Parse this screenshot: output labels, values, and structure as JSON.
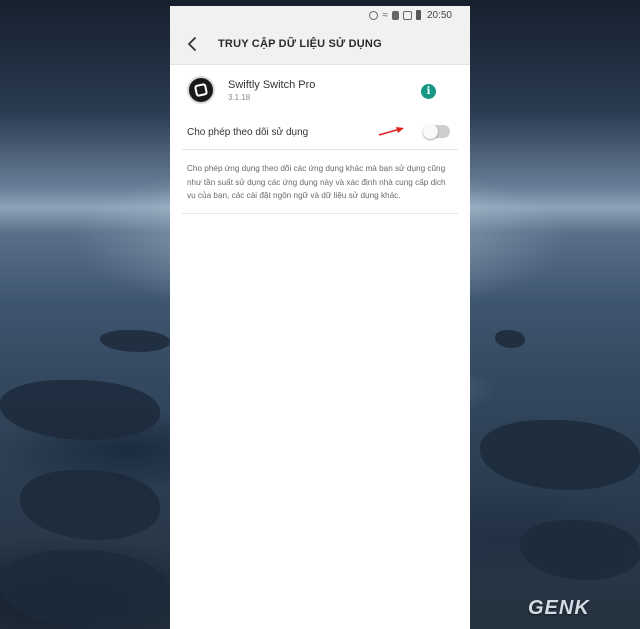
{
  "status_bar": {
    "time": "20:50",
    "icons": [
      "alarm-icon",
      "wifi-icon",
      "sim-icon",
      "signal-icon",
      "battery-icon"
    ]
  },
  "app_bar": {
    "back_icon": "back-arrow-icon",
    "title": "TRUY CẬP DỮ LIỆU SỬ DỤNG"
  },
  "app_info": {
    "name": "Swiftly Switch Pro",
    "version": "3.1.18",
    "info_icon": "info-icon",
    "info_symbol": "i"
  },
  "usage_access": {
    "label": "Cho phép theo dõi sử dụng",
    "enabled": false
  },
  "description": "Cho phép ứng dụng theo dõi các ứng dụng khác mà bạn sử dụng cũng như tần suất sử dụng các ứng dụng này và xác định nhà cung cấp dịch vụ của bạn, các cài đặt ngôn ngữ và dữ liệu sử dụng khác.",
  "watermark": "GENK",
  "colors": {
    "accent": "#179884",
    "annotation_arrow": "#e02020"
  }
}
